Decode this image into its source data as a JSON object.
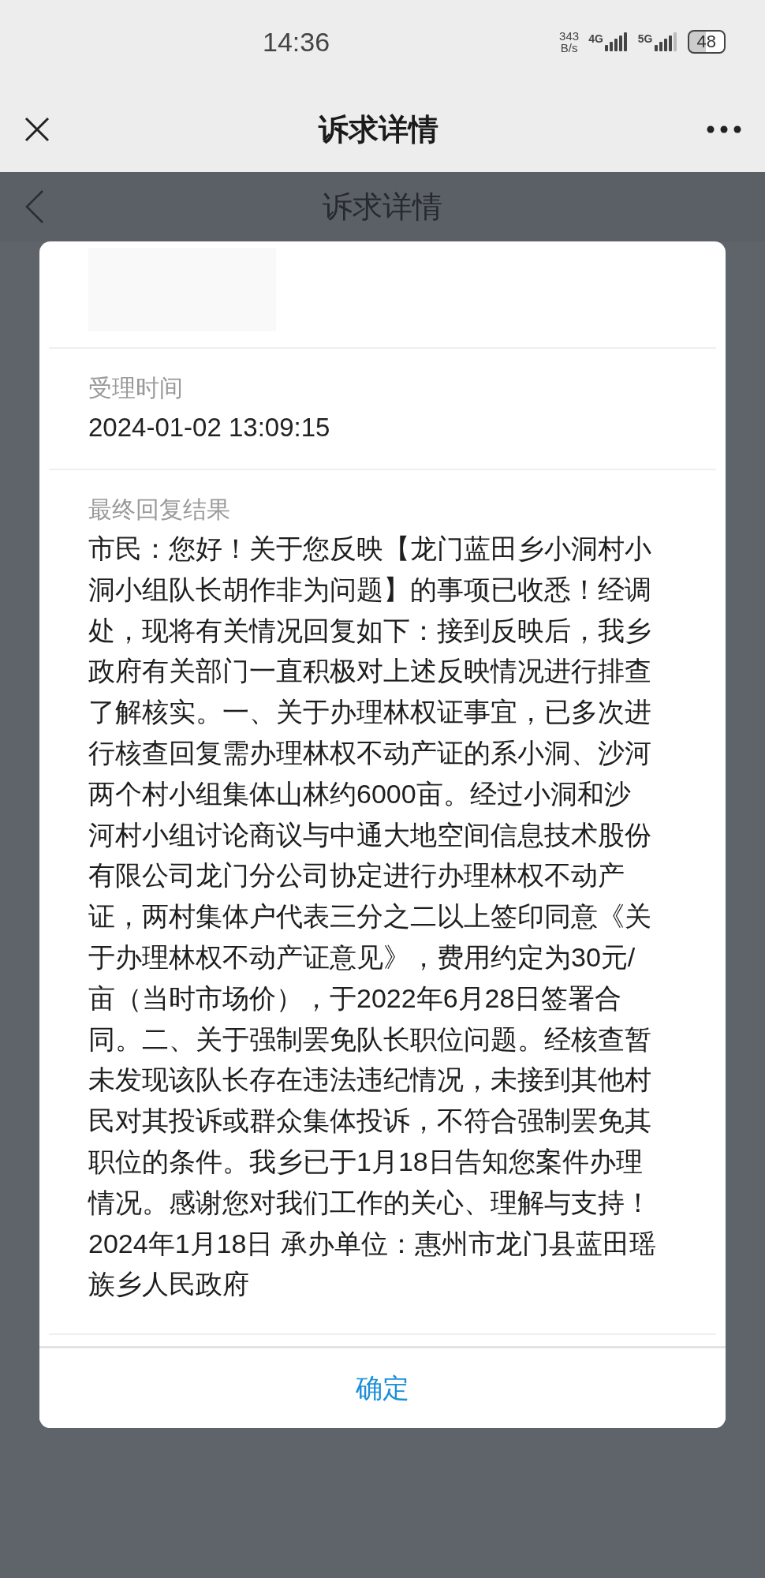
{
  "status_bar": {
    "time": "14:36",
    "speed_value": "343",
    "speed_unit": "B/s",
    "networks": [
      "4G",
      "5G"
    ],
    "battery": "48"
  },
  "nav": {
    "title": "诉求详情"
  },
  "background_page": {
    "title": "诉求详情"
  },
  "dialog": {
    "accept_time": {
      "label": "受理时间",
      "value": "2024-01-02 13:09:15"
    },
    "final_reply": {
      "label": "最终回复结果",
      "text": "市民：您好！关于您反映【龙门蓝田乡小洞村小洞小组队长胡作非为问题】的事项已收悉！经调处，现将有关情况回复如下：接到反映后，我乡政府有关部门一直积极对上述反映情况进行排查了解核实。一、关于办理林权证事宜，已多次进行核查回复需办理林权不动产证的系小洞、沙河两个村小组集体山林约6000亩。经过小洞和沙河村小组讨论商议与中通大地空间信息技术股份有限公司龙门分公司协定进行办理林权不动产证，两村集体户代表三分之二以上签印同意《关于办理林权不动产证意见》，费用约定为30元/亩（当时市场价），于2022年6月28日签署合同。二、关于强制罢免队长职位问题。经核查暂未发现该队长存在违法违纪情况，未接到其他村民对其投诉或群众集体投诉，不符合强制罢免其职位的条件。我乡已于1月18日告知您案件办理情况。感谢您对我们工作的关心、理解与支持！2024年1月18日 承办单位：惠州市龙门县蓝田瑶族乡人民政府"
    },
    "button": "确定"
  }
}
